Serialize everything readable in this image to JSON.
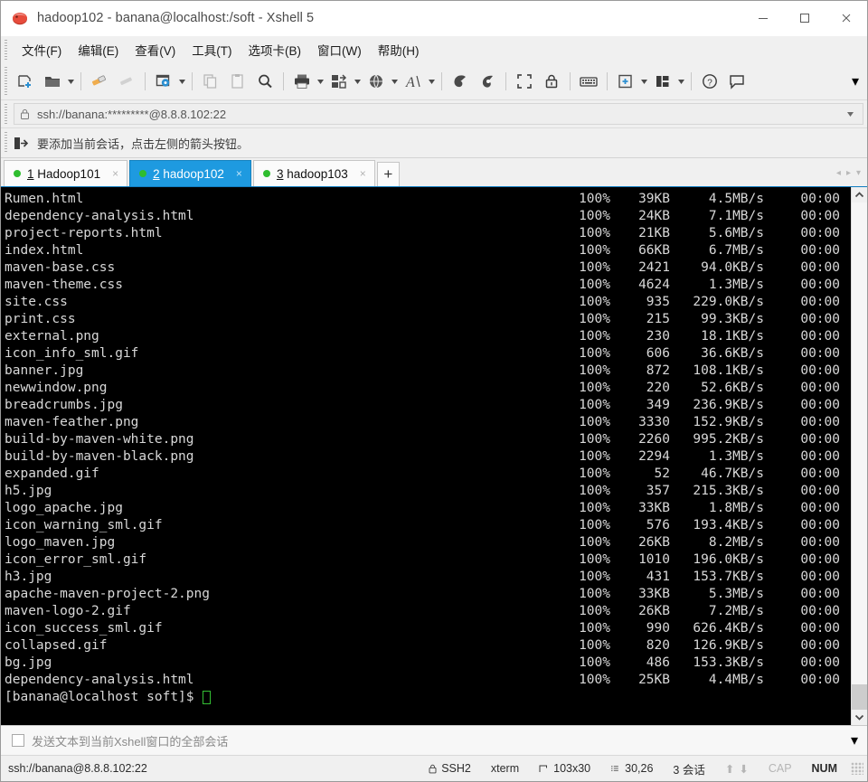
{
  "window": {
    "title": "hadoop102 - banana@localhost:/soft - Xshell 5",
    "app_icon": "xshell-icon",
    "minimize_label": "—",
    "maximize_label": "□",
    "close_label": "✕"
  },
  "menu": {
    "items": [
      {
        "label": "文件(F)",
        "name": "menu-file"
      },
      {
        "label": "编辑(E)",
        "name": "menu-edit"
      },
      {
        "label": "查看(V)",
        "name": "menu-view"
      },
      {
        "label": "工具(T)",
        "name": "menu-tools"
      },
      {
        "label": "选项卡(B)",
        "name": "menu-tabs"
      },
      {
        "label": "窗口(W)",
        "name": "menu-window"
      },
      {
        "label": "帮助(H)",
        "name": "menu-help"
      }
    ]
  },
  "toolbar": {
    "overflow_label": "▾"
  },
  "address": {
    "value": "ssh://banana:*********@8.8.8.102:22",
    "lock_icon": "lock-icon",
    "dropdown_label": "▾"
  },
  "session_note": {
    "text": "要添加当前会话，点击左侧的箭头按钮。",
    "icon": "add-session-icon"
  },
  "tabs": {
    "items": [
      {
        "num": "1",
        "label": " Hadoop101",
        "active": false,
        "close": "×"
      },
      {
        "num": "2",
        "label": " hadoop102",
        "active": true,
        "close": "×"
      },
      {
        "num": "3",
        "label": " hadoop103",
        "active": false,
        "close": "×"
      }
    ],
    "add_label": "+",
    "nav_prev": "◂",
    "nav_next": "▸",
    "nav_menu": "▾"
  },
  "terminal": {
    "rows": [
      {
        "name": "Rumen.html",
        "pct": "100%",
        "size": "39KB",
        "rate": "4.5MB/s",
        "time": "00:00"
      },
      {
        "name": "dependency-analysis.html",
        "pct": "100%",
        "size": "24KB",
        "rate": "7.1MB/s",
        "time": "00:00"
      },
      {
        "name": "project-reports.html",
        "pct": "100%",
        "size": "21KB",
        "rate": "5.6MB/s",
        "time": "00:00"
      },
      {
        "name": "index.html",
        "pct": "100%",
        "size": "66KB",
        "rate": "6.7MB/s",
        "time": "00:00"
      },
      {
        "name": "maven-base.css",
        "pct": "100%",
        "size": "2421",
        "rate": "94.0KB/s",
        "time": "00:00"
      },
      {
        "name": "maven-theme.css",
        "pct": "100%",
        "size": "4624",
        "rate": "1.3MB/s",
        "time": "00:00"
      },
      {
        "name": "site.css",
        "pct": "100%",
        "size": "935",
        "rate": "229.0KB/s",
        "time": "00:00"
      },
      {
        "name": "print.css",
        "pct": "100%",
        "size": "215",
        "rate": "99.3KB/s",
        "time": "00:00"
      },
      {
        "name": "external.png",
        "pct": "100%",
        "size": "230",
        "rate": "18.1KB/s",
        "time": "00:00"
      },
      {
        "name": "icon_info_sml.gif",
        "pct": "100%",
        "size": "606",
        "rate": "36.6KB/s",
        "time": "00:00"
      },
      {
        "name": "banner.jpg",
        "pct": "100%",
        "size": "872",
        "rate": "108.1KB/s",
        "time": "00:00"
      },
      {
        "name": "newwindow.png",
        "pct": "100%",
        "size": "220",
        "rate": "52.6KB/s",
        "time": "00:00"
      },
      {
        "name": "breadcrumbs.jpg",
        "pct": "100%",
        "size": "349",
        "rate": "236.9KB/s",
        "time": "00:00"
      },
      {
        "name": "maven-feather.png",
        "pct": "100%",
        "size": "3330",
        "rate": "152.9KB/s",
        "time": "00:00"
      },
      {
        "name": "build-by-maven-white.png",
        "pct": "100%",
        "size": "2260",
        "rate": "995.2KB/s",
        "time": "00:00"
      },
      {
        "name": "build-by-maven-black.png",
        "pct": "100%",
        "size": "2294",
        "rate": "1.3MB/s",
        "time": "00:00"
      },
      {
        "name": "expanded.gif",
        "pct": "100%",
        "size": "52",
        "rate": "46.7KB/s",
        "time": "00:00"
      },
      {
        "name": "h5.jpg",
        "pct": "100%",
        "size": "357",
        "rate": "215.3KB/s",
        "time": "00:00"
      },
      {
        "name": "logo_apache.jpg",
        "pct": "100%",
        "size": "33KB",
        "rate": "1.8MB/s",
        "time": "00:00"
      },
      {
        "name": "icon_warning_sml.gif",
        "pct": "100%",
        "size": "576",
        "rate": "193.4KB/s",
        "time": "00:00"
      },
      {
        "name": "logo_maven.jpg",
        "pct": "100%",
        "size": "26KB",
        "rate": "8.2MB/s",
        "time": "00:00"
      },
      {
        "name": "icon_error_sml.gif",
        "pct": "100%",
        "size": "1010",
        "rate": "196.0KB/s",
        "time": "00:00"
      },
      {
        "name": "h3.jpg",
        "pct": "100%",
        "size": "431",
        "rate": "153.7KB/s",
        "time": "00:00"
      },
      {
        "name": "apache-maven-project-2.png",
        "pct": "100%",
        "size": "33KB",
        "rate": "5.3MB/s",
        "time": "00:00"
      },
      {
        "name": "maven-logo-2.gif",
        "pct": "100%",
        "size": "26KB",
        "rate": "7.2MB/s",
        "time": "00:00"
      },
      {
        "name": "icon_success_sml.gif",
        "pct": "100%",
        "size": "990",
        "rate": "626.4KB/s",
        "time": "00:00"
      },
      {
        "name": "collapsed.gif",
        "pct": "100%",
        "size": "820",
        "rate": "126.9KB/s",
        "time": "00:00"
      },
      {
        "name": "bg.jpg",
        "pct": "100%",
        "size": "486",
        "rate": "153.3KB/s",
        "time": "00:00"
      },
      {
        "name": "dependency-analysis.html",
        "pct": "100%",
        "size": "25KB",
        "rate": "4.4MB/s",
        "time": "00:00"
      }
    ],
    "prompt": "[banana@localhost soft]$",
    "cursor_color": "#34c034",
    "background": "#000000",
    "foreground": "#d8d8d8"
  },
  "send_bar": {
    "text": "发送文本到当前Xshell窗口的全部会话",
    "caret": "▾"
  },
  "status": {
    "connection": "ssh://banana@8.8.8.102:22",
    "protocol": "SSH2",
    "terminal_type": "xterm",
    "size": "103x30",
    "cursor_position": "30,26",
    "sessions": "3 会话",
    "cap": "CAP",
    "num": "NUM",
    "up_arrow": "⬆",
    "down_arrow": "⬇"
  },
  "colors": {
    "accent": "#1e9ae0",
    "chrome": "#f0f0f0",
    "terminal_bg": "#000000",
    "tab_dot": "#2fbd2f"
  }
}
